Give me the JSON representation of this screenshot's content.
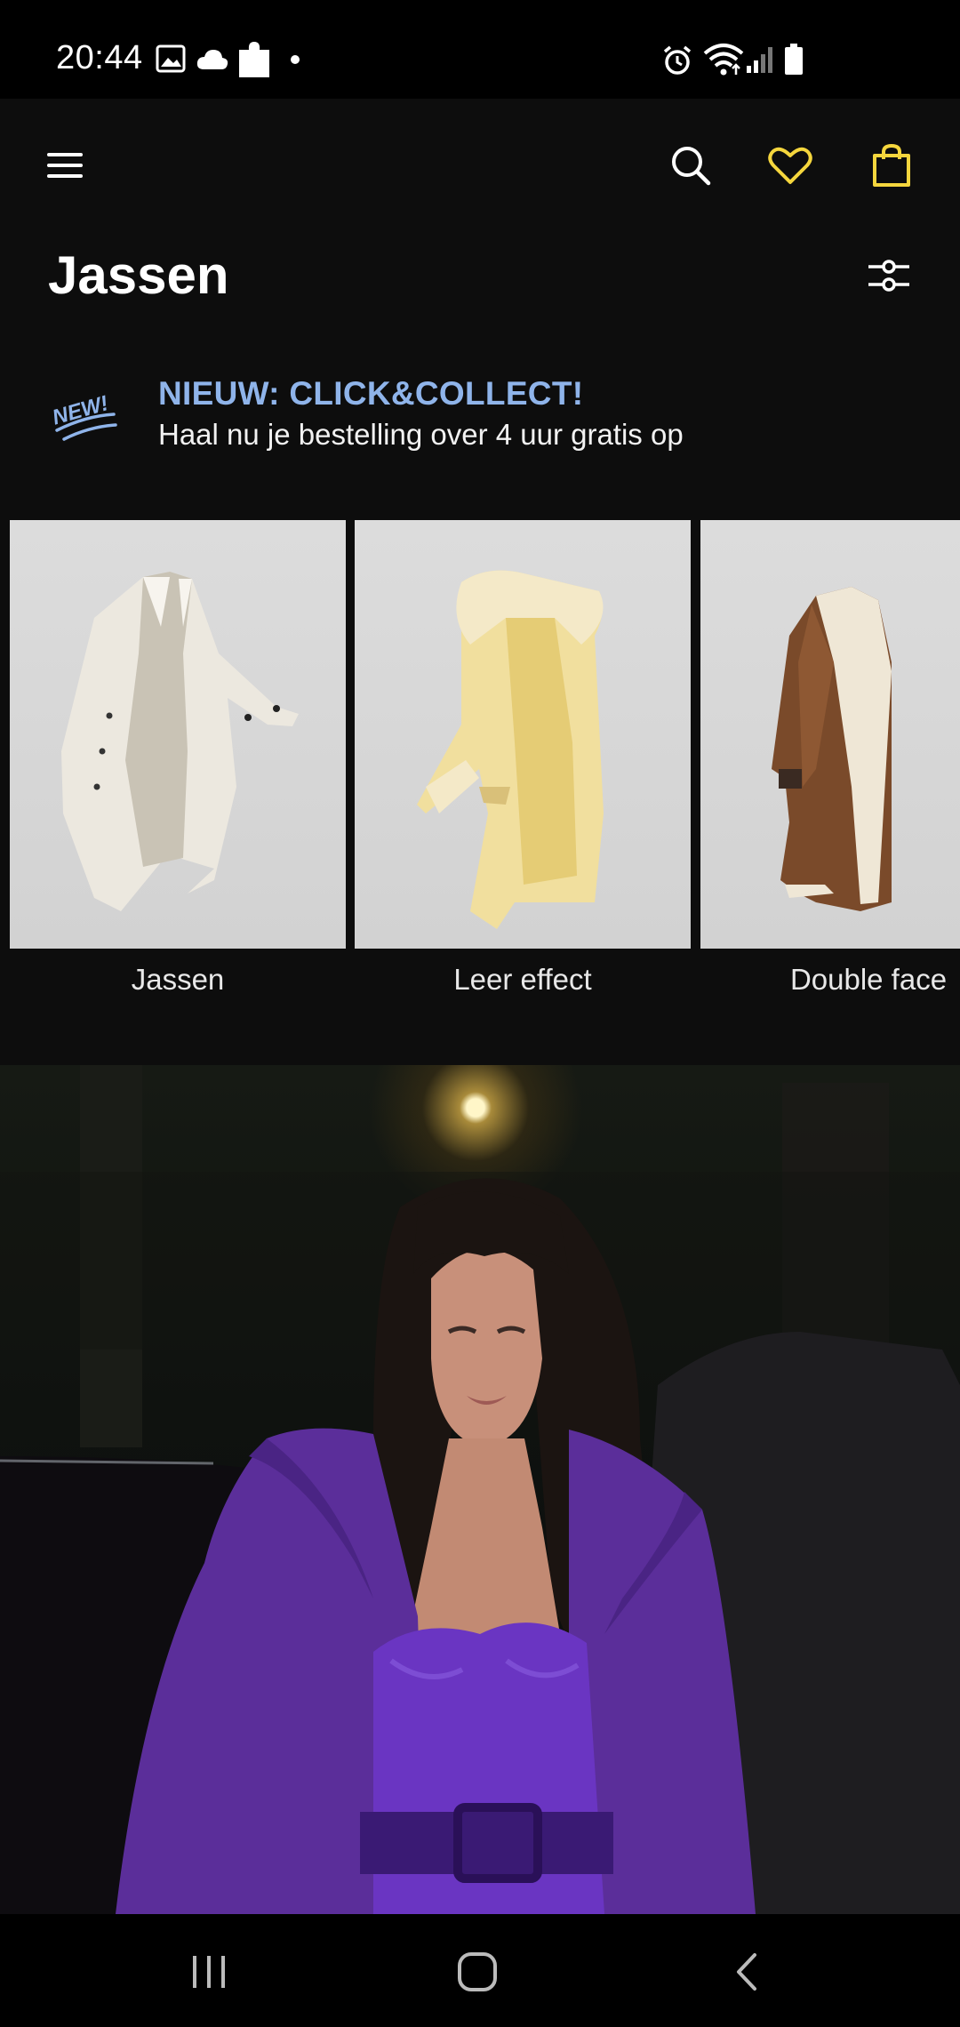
{
  "status_bar": {
    "time": "20:44",
    "left_icons": [
      "image-icon",
      "cloud-icon",
      "puzzle-icon",
      "dot-icon"
    ],
    "right_icons": [
      "alarm-icon",
      "wifi-icon",
      "signal-icon",
      "battery-icon"
    ]
  },
  "app_bar": {
    "menu_icon": "hamburger-menu-icon",
    "search_icon": "search-icon",
    "wishlist_icon": "heart-icon",
    "bag_icon": "shopping-bag-icon",
    "accent_color": "#f5d63d"
  },
  "page": {
    "title": "Jassen",
    "filter_icon": "filter-sliders-icon"
  },
  "promo": {
    "badge": "NEW!",
    "title": "NIEUW: CLICK&COLLECT!",
    "subtitle": "Haal nu je bestelling over 4 uur gratis op",
    "title_color": "#8fb4ea"
  },
  "categories": [
    {
      "label": "Jassen"
    },
    {
      "label": "Leer effect"
    },
    {
      "label": "Double face"
    }
  ],
  "hero": {
    "description_icon": "campaign-photo"
  },
  "nav_bar": {
    "icons": [
      "recent-apps-icon",
      "home-icon",
      "back-icon"
    ]
  }
}
